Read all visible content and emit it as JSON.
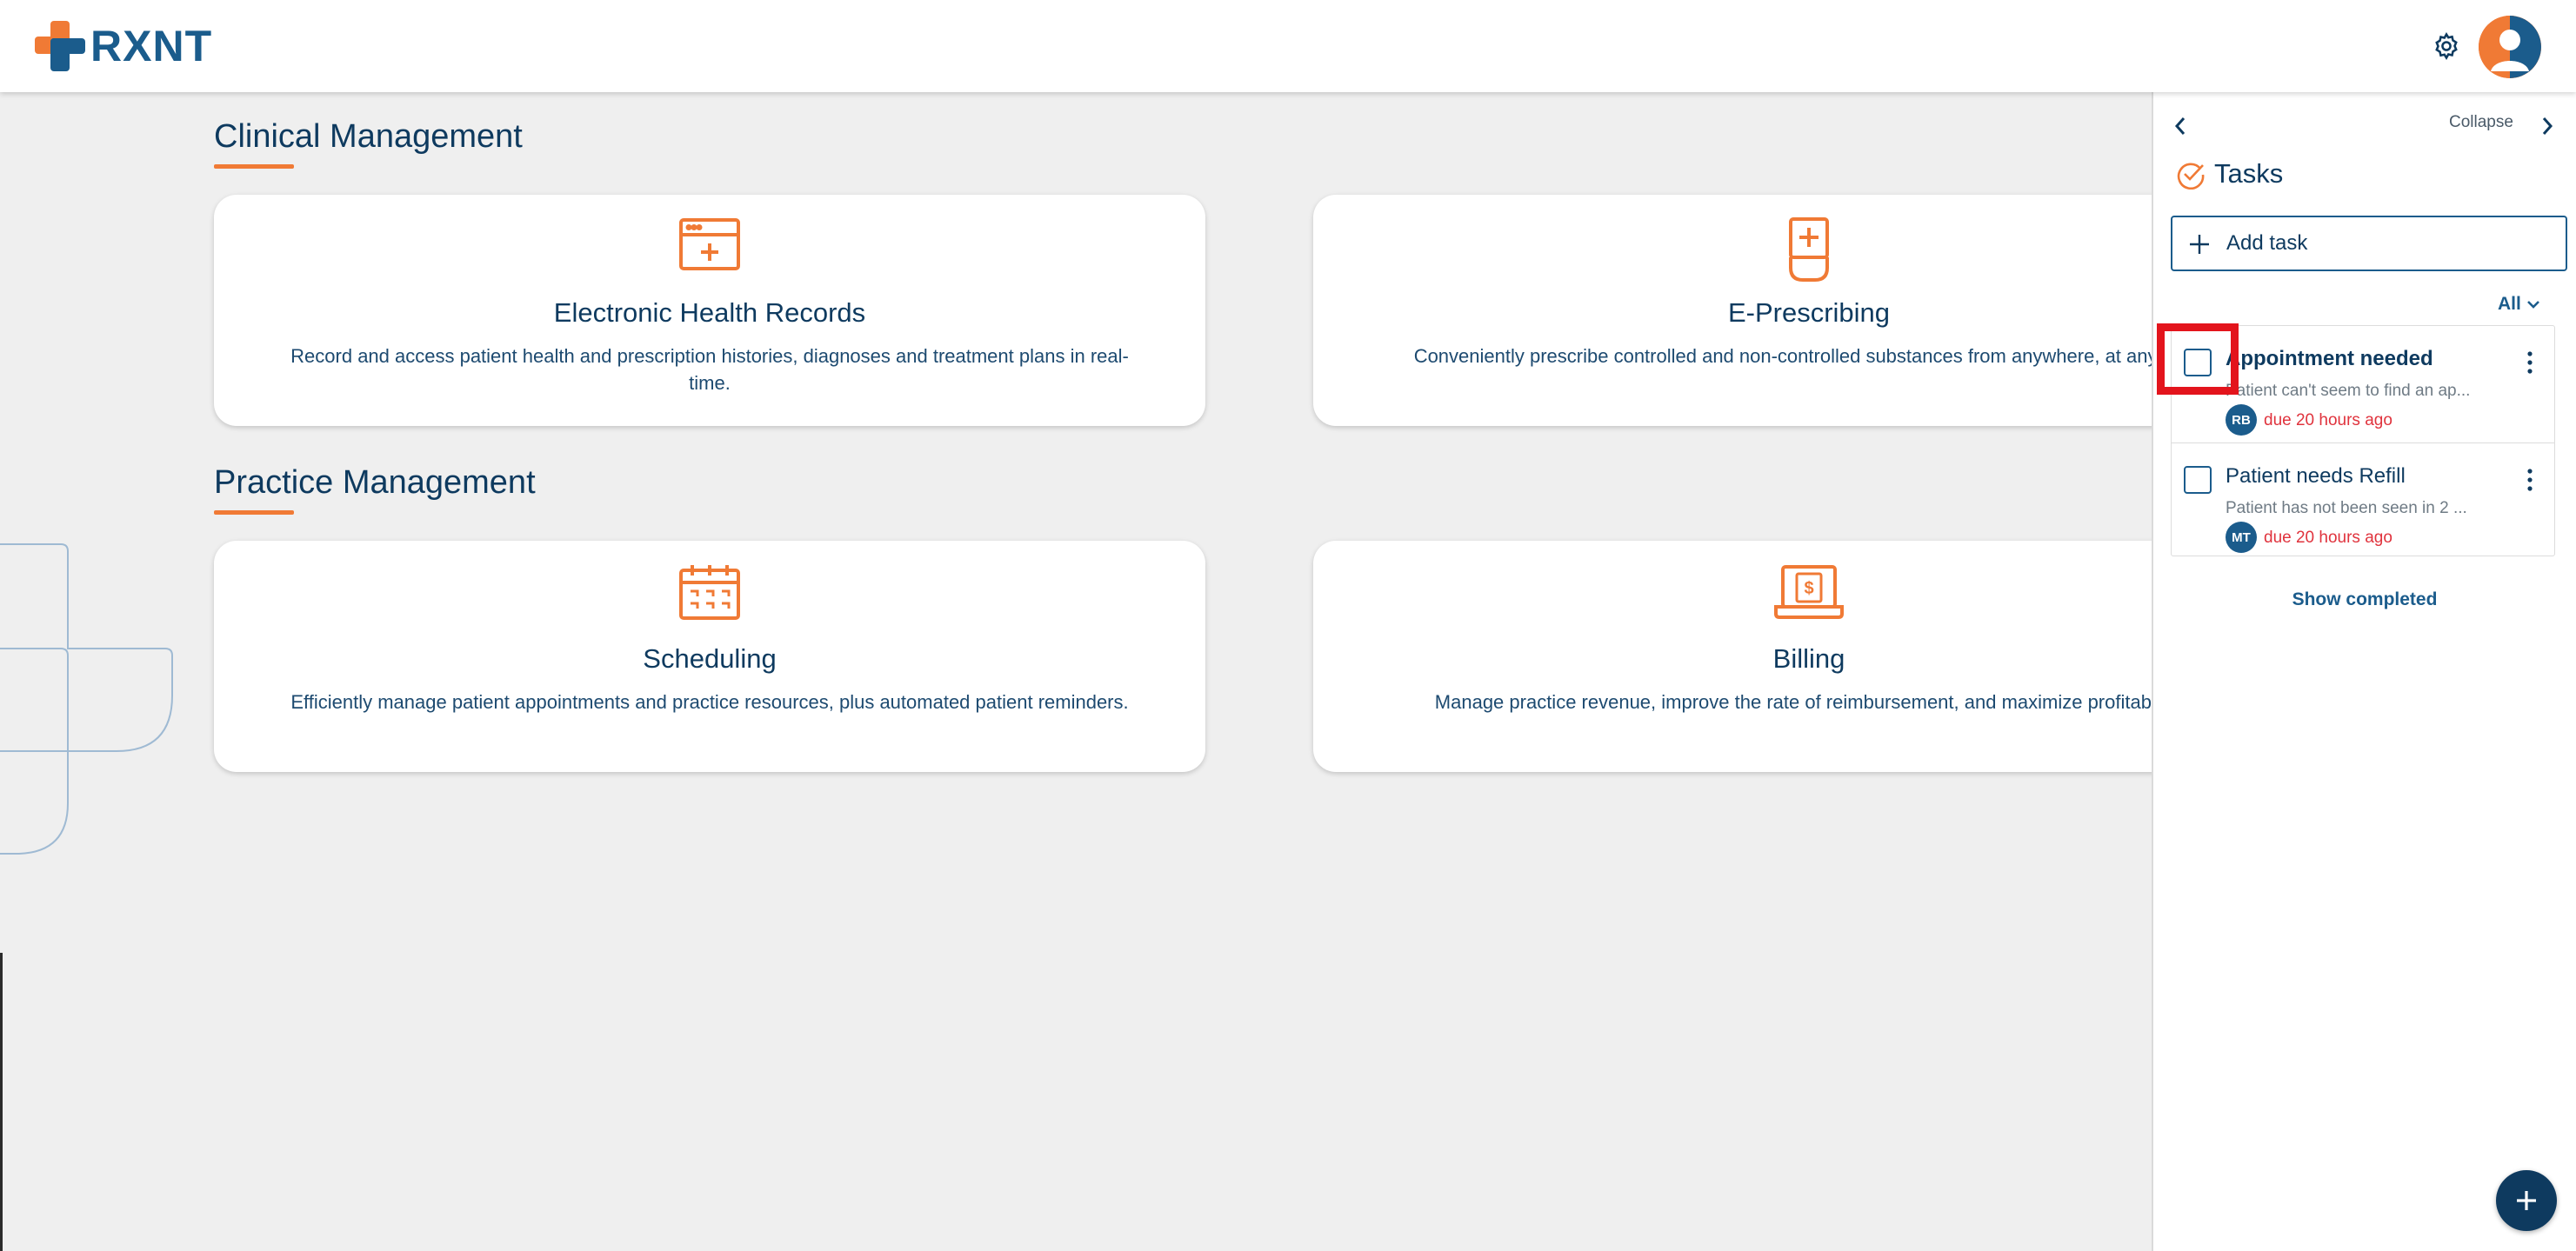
{
  "header": {
    "logo_text": "RXNT",
    "icons": [
      "settings-gear-icon",
      "user-avatar"
    ]
  },
  "colors": {
    "brand_blue": "#1b5c8c",
    "navy": "#0e3a5f",
    "orange": "#f07a35",
    "due_red": "#e0333d",
    "highlight_red": "#e3141c"
  },
  "main": {
    "sections": [
      {
        "title": "Clinical Management",
        "cards": [
          {
            "title": "Electronic Health Records",
            "description": "Record and access patient health and prescription histories, diagnoses and treatment plans in real-time.",
            "icon": "ehr-browser-icon"
          },
          {
            "title": "E-Prescribing",
            "description": "Conveniently prescribe controlled and non-controlled substances from anywhere, at any time.",
            "icon": "prescription-bottle-icon"
          }
        ]
      },
      {
        "title": "Practice Management",
        "cards": [
          {
            "title": "Scheduling",
            "description": "Efficiently manage patient appointments and practice resources, plus automated patient reminders.",
            "icon": "calendar-icon"
          },
          {
            "title": "Billing",
            "description": "Manage practice revenue, improve the rate of reimbursement, and maximize profitability.",
            "icon": "laptop-dollar-icon"
          }
        ]
      }
    ]
  },
  "panel": {
    "collapse_label": "Collapse",
    "title": "Tasks",
    "add_task_label": "Add task",
    "filter_label": "All",
    "tasks": [
      {
        "title": "Appointment needed",
        "description": "Patient can't seem to find an ap...",
        "assignee": "RB",
        "due": "due 20 hours ago",
        "checked": false
      },
      {
        "title": "Patient needs Refill",
        "description": "Patient has not been seen in 2 ...",
        "assignee": "MT",
        "due": "due 20 hours ago",
        "checked": false
      }
    ],
    "show_completed_label": "Show completed"
  }
}
